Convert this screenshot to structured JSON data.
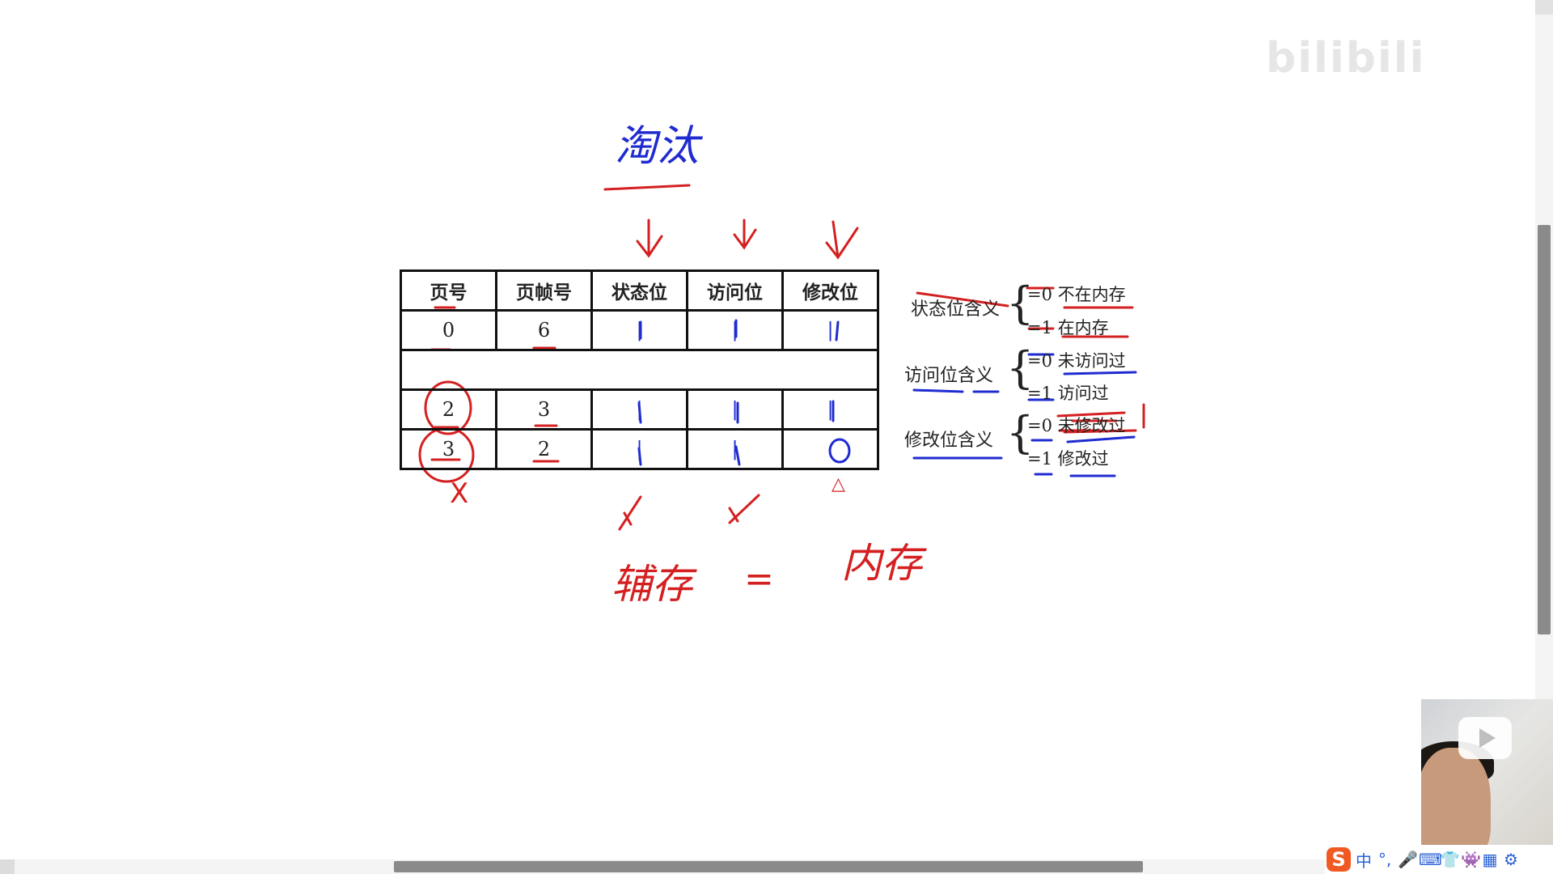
{
  "table": {
    "headers": [
      "页号",
      "页帧号",
      "状态位",
      "访问位",
      "修改位"
    ],
    "rows": [
      [
        "0",
        "6",
        "|",
        "|",
        "|"
      ],
      [
        "",
        "",
        "",
        "",
        ""
      ],
      [
        "2",
        "3",
        "|",
        "|",
        "|"
      ],
      [
        "3",
        "2",
        "|",
        "|",
        "0"
      ]
    ]
  },
  "legend": [
    {
      "label": "状态位含义",
      "zero": "=0 不在内存",
      "one": "=1 在内存"
    },
    {
      "label": "访问位含义",
      "zero": "=0 未访问过",
      "one": "=1 访问过"
    },
    {
      "label": "修改位含义",
      "zero": "=0 未修改过",
      "one": "=1 修改过"
    }
  ],
  "handwriting": {
    "top": "淘汰",
    "bottom_left": "辅存",
    "equals": "=",
    "bottom_right": "内存",
    "mark_x": "X",
    "mark_triangle": "△"
  },
  "watermark": "bilibili",
  "ime": {
    "logo": "S",
    "items": [
      "中",
      "°,",
      "🎤",
      "⌨",
      "👕",
      "👾",
      "▦",
      "⚙"
    ]
  },
  "colors": {
    "red_ink": "#d42020",
    "blue_ink": "#1f2bd0",
    "ime_orange": "#f05a22"
  }
}
